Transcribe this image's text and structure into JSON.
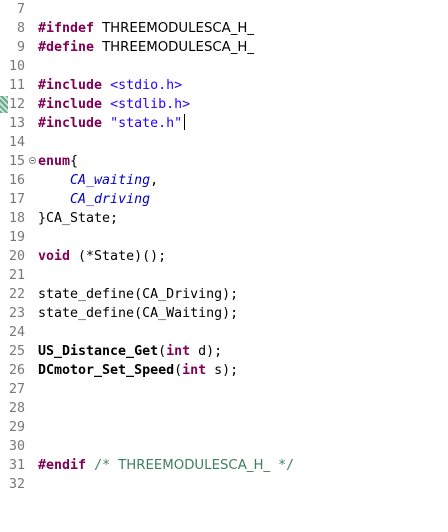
{
  "editor": {
    "lines": [
      {
        "num": "7"
      },
      {
        "num": "8",
        "directive": "#ifndef",
        "macro": "THREEMODULESCA_H_"
      },
      {
        "num": "9",
        "directive": "#define",
        "macro": "THREEMODULESCA_H_"
      },
      {
        "num": "10"
      },
      {
        "num": "11",
        "directive": "#include",
        "header": "<stdio.h>"
      },
      {
        "num": "12",
        "directive": "#include",
        "header": "<stdlib.h>"
      },
      {
        "num": "13",
        "directive": "#include",
        "header": "\"state.h\""
      },
      {
        "num": "14"
      },
      {
        "num": "15",
        "keyword": "enum",
        "text": "{"
      },
      {
        "num": "16",
        "enumerator": "CA_waiting",
        "text": ","
      },
      {
        "num": "17",
        "enumerator": "CA_driving"
      },
      {
        "num": "18",
        "text": "}CA_State;"
      },
      {
        "num": "19"
      },
      {
        "num": "20",
        "keyword": "void",
        "text": " (*State)();"
      },
      {
        "num": "21"
      },
      {
        "num": "22",
        "text": "state_define(CA_Driving);"
      },
      {
        "num": "23",
        "text": "state_define(CA_Waiting);"
      },
      {
        "num": "24"
      },
      {
        "num": "25",
        "func": "US_Distance_Get",
        "text_open": "(",
        "type": "int",
        "text_close": " d);"
      },
      {
        "num": "26",
        "func": "DCmotor_Set_Speed",
        "text_open": "(",
        "type": "int",
        "text_close": " s);"
      },
      {
        "num": "27"
      },
      {
        "num": "28"
      },
      {
        "num": "29"
      },
      {
        "num": "30"
      },
      {
        "num": "31",
        "directive": "#endif",
        "comment_open": "/* ",
        "comment_macro": "THREEMODULESCA_H_",
        "comment_close": " */"
      },
      {
        "num": "32"
      }
    ]
  },
  "colors": {
    "preprocessor_keyword": "#7f0055",
    "string": "#2a00ff",
    "enumerator": "#0000c0",
    "comment": "#3f7f5f",
    "line_number": "#787878"
  }
}
